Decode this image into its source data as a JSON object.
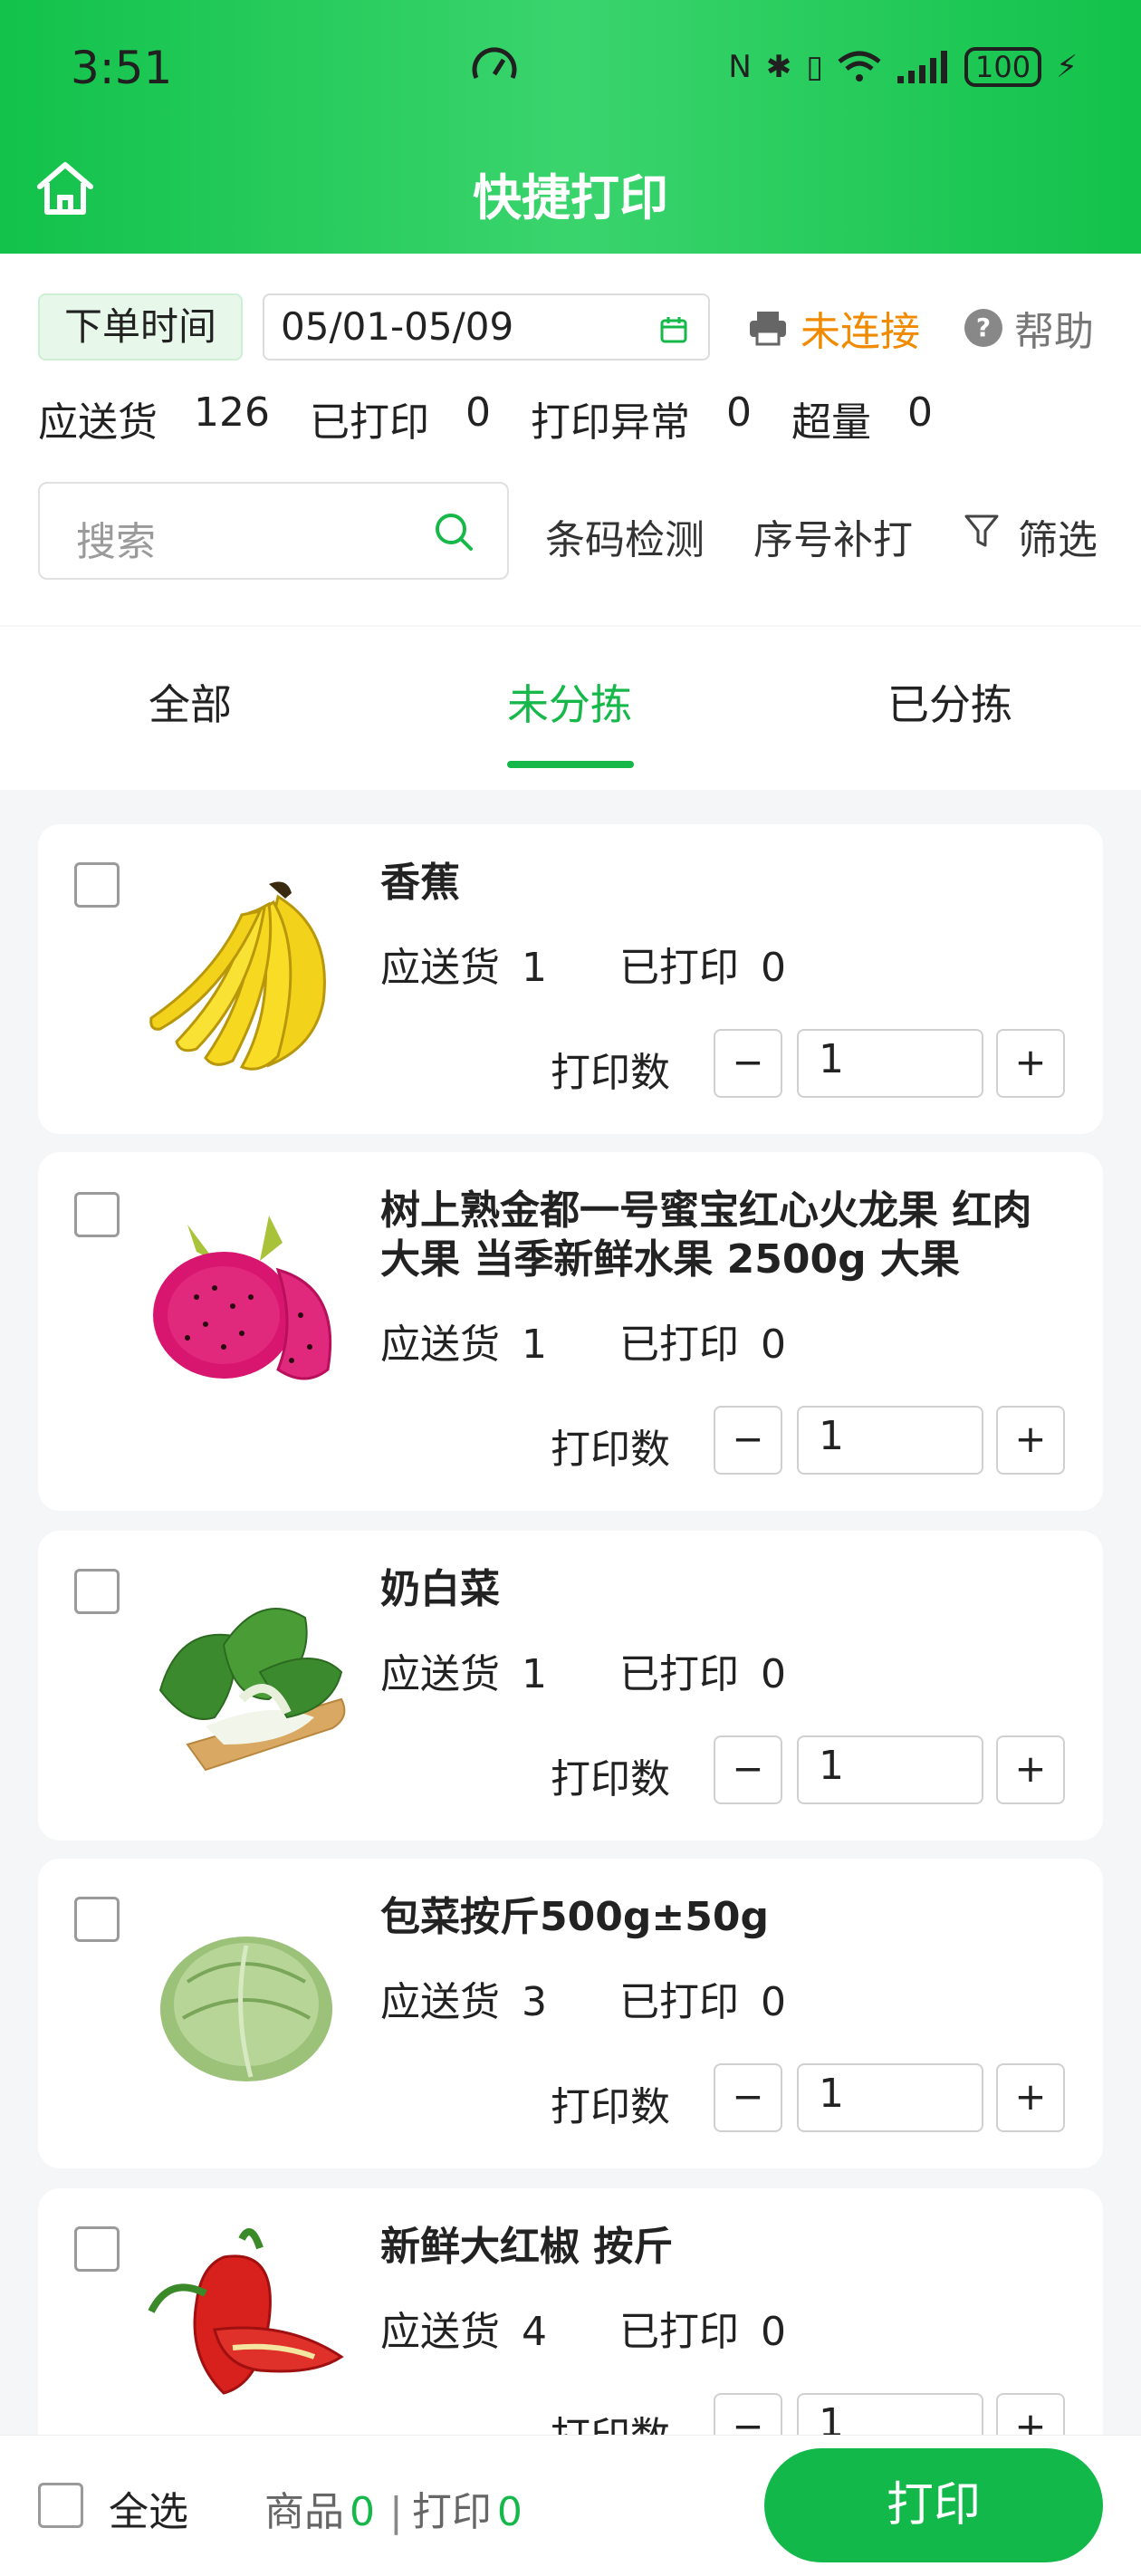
{
  "status_bar": {
    "time": "3:51",
    "battery": "100"
  },
  "header": {
    "title": "快捷打印"
  },
  "filter": {
    "date_label": "下单时间",
    "date_range": "05/01-05/09",
    "printer_status": "未连接",
    "help_label": "帮助",
    "stats": [
      {
        "label": "应送货",
        "value": "126"
      },
      {
        "label": "已打印",
        "value": "0"
      },
      {
        "label": "打印异常",
        "value": "0"
      },
      {
        "label": "超量",
        "value": "0"
      }
    ],
    "search_placeholder": "搜索",
    "barcode_check": "条码检测",
    "serial_reprint": "序号补打",
    "filter_label": "筛选"
  },
  "tabs": [
    {
      "label": "全部",
      "active": false
    },
    {
      "label": "未分拣",
      "active": true
    },
    {
      "label": "已分拣",
      "active": false
    }
  ],
  "items": [
    {
      "name": "香蕉",
      "image": "banana",
      "deliver_label": "应送货",
      "deliver": "1",
      "printed_label": "已打印",
      "printed": "0",
      "qty_label": "打印数",
      "qty": "1"
    },
    {
      "name": "树上熟金都一号蜜宝红心火龙果 红肉大果 当季新鲜水果 2500g 大果",
      "image": "dragon-fruit",
      "deliver_label": "应送货",
      "deliver": "1",
      "printed_label": "已打印",
      "printed": "0",
      "qty_label": "打印数",
      "qty": "1"
    },
    {
      "name": "奶白菜",
      "image": "bok-choy",
      "deliver_label": "应送货",
      "deliver": "1",
      "printed_label": "已打印",
      "printed": "0",
      "qty_label": "打印数",
      "qty": "1"
    },
    {
      "name": "包菜按斤500g±50g",
      "image": "cabbage",
      "deliver_label": "应送货",
      "deliver": "3",
      "printed_label": "已打印",
      "printed": "0",
      "qty_label": "打印数",
      "qty": "1"
    },
    {
      "name": "新鲜大红椒 按斤",
      "image": "red-pepper",
      "deliver_label": "应送货",
      "deliver": "4",
      "printed_label": "已打印",
      "printed": "0",
      "qty_label": "打印数",
      "qty": "1"
    }
  ],
  "stepper": {
    "minus": "−",
    "plus": "+"
  },
  "bottom": {
    "select_all": "全选",
    "goods_label": "商品",
    "goods_count": "0",
    "separator": "|",
    "print_label": "打印",
    "print_count": "0",
    "print_button": "打印"
  },
  "colors": {
    "brand_green": "#17b84a",
    "warning_orange": "#f08a00"
  }
}
